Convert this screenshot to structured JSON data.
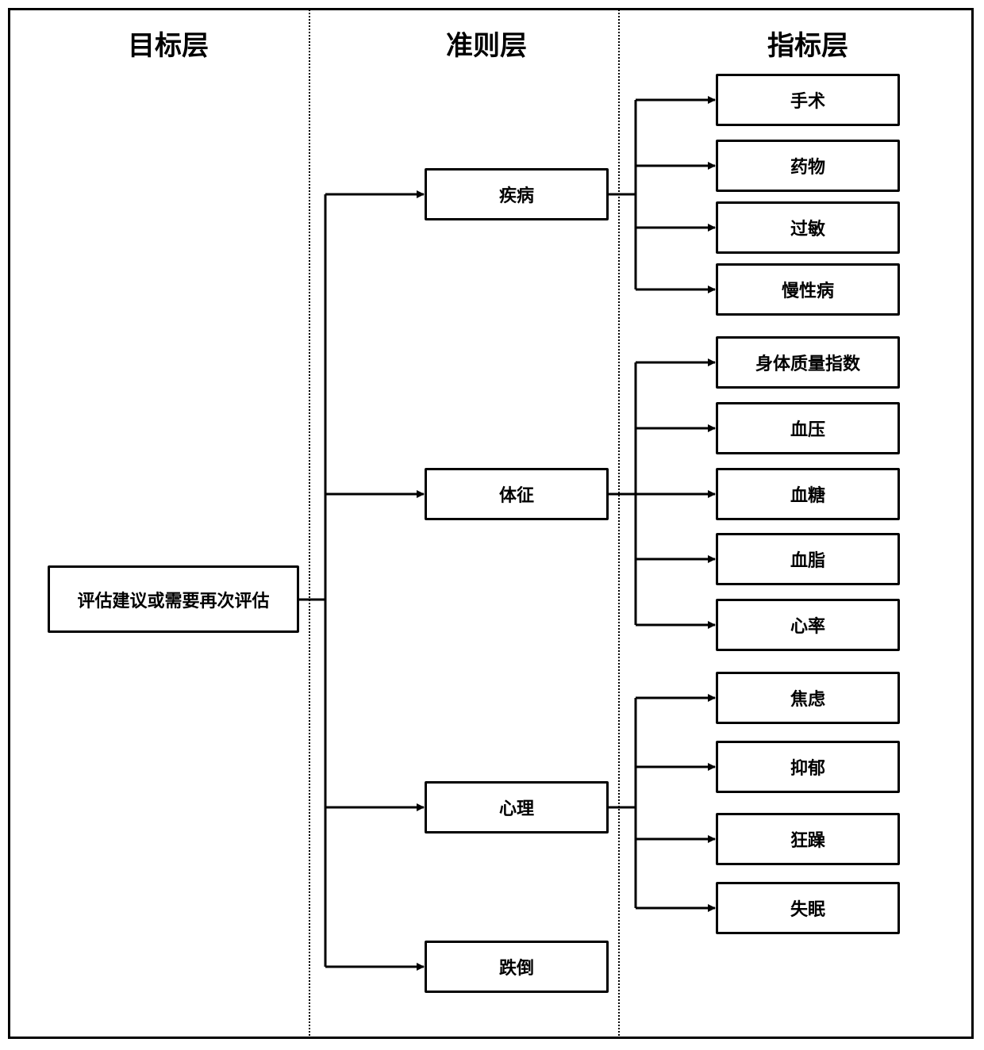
{
  "columns": [
    {
      "title": "目标层"
    },
    {
      "title": "准则层"
    },
    {
      "title": "指标层"
    }
  ],
  "goal": {
    "label": "评估建议或需要再次评估"
  },
  "criteria": [
    {
      "label": "疾病",
      "indicators": [
        "手术",
        "药物",
        "过敏",
        "慢性病"
      ]
    },
    {
      "label": "体征",
      "indicators": [
        "身体质量指数",
        "血压",
        "血糖",
        "血脂",
        "心率"
      ]
    },
    {
      "label": "心理",
      "indicators": [
        "焦虑",
        "抑郁",
        "狂躁",
        "失眠"
      ]
    },
    {
      "label": "跌倒",
      "indicators": []
    }
  ]
}
